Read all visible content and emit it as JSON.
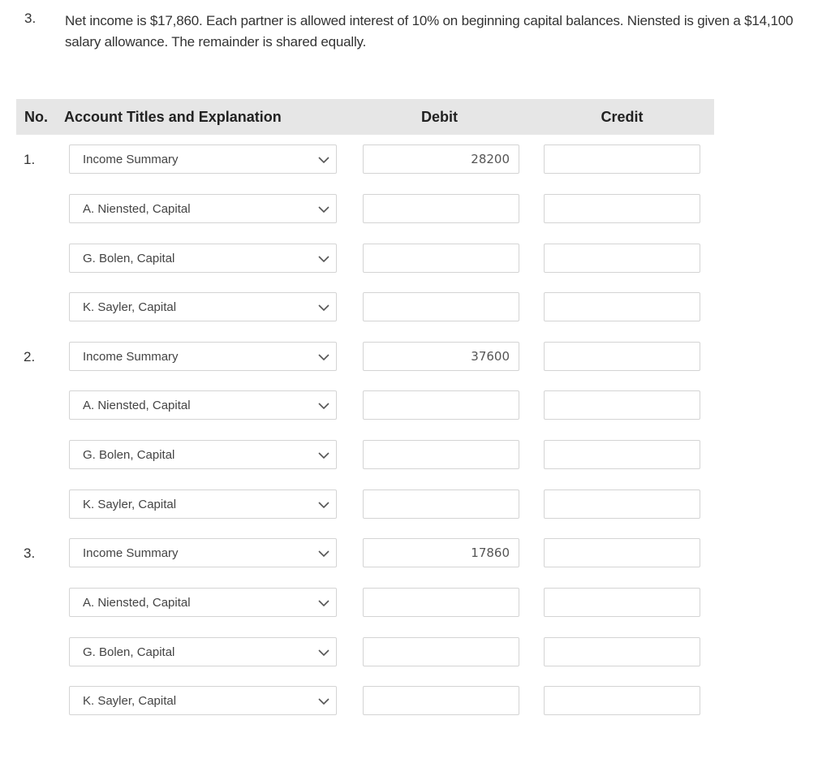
{
  "question": {
    "number": "3.",
    "text": "Net income is $17,860. Each partner is allowed interest of 10% on beginning capital balances. Niensted is given a $14,100 salary allowance. The remainder is shared equally."
  },
  "table": {
    "headers": {
      "no": "No.",
      "account": "Account Titles and Explanation",
      "debit": "Debit",
      "credit": "Credit"
    },
    "rows": [
      {
        "no": "1.",
        "account": "Income Summary",
        "debit": "28200",
        "credit": ""
      },
      {
        "no": "",
        "account": "A. Niensted, Capital",
        "debit": "",
        "credit": ""
      },
      {
        "no": "",
        "account": "G. Bolen, Capital",
        "debit": "",
        "credit": ""
      },
      {
        "no": "",
        "account": "K. Sayler, Capital",
        "debit": "",
        "credit": ""
      },
      {
        "no": "2.",
        "account": "Income Summary",
        "debit": "37600",
        "credit": ""
      },
      {
        "no": "",
        "account": "A. Niensted, Capital",
        "debit": "",
        "credit": ""
      },
      {
        "no": "",
        "account": "G. Bolen, Capital",
        "debit": "",
        "credit": ""
      },
      {
        "no": "",
        "account": "K. Sayler, Capital",
        "debit": "",
        "credit": ""
      },
      {
        "no": "3.",
        "account": "Income Summary",
        "debit": "17860",
        "credit": ""
      },
      {
        "no": "",
        "account": "A. Niensted, Capital",
        "debit": "",
        "credit": ""
      },
      {
        "no": "",
        "account": "G. Bolen, Capital",
        "debit": "",
        "credit": ""
      },
      {
        "no": "",
        "account": "K. Sayler, Capital",
        "debit": "",
        "credit": ""
      }
    ]
  },
  "icons": {
    "dropdown": "chevron-down-icon"
  }
}
